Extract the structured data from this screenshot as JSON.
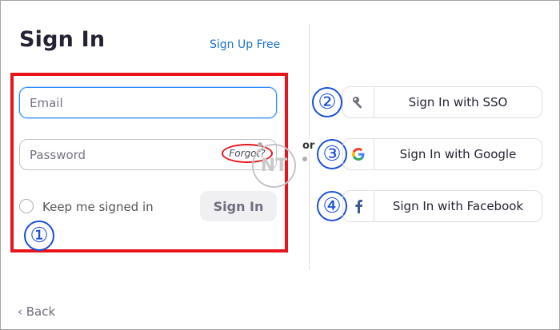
{
  "signin": {
    "title": "Sign In",
    "signup_link": "Sign Up Free",
    "email_placeholder": "Email",
    "password_placeholder": "Password",
    "forgot": "Forgot?",
    "keep_signed_in": "Keep me signed in",
    "button": "Sign In"
  },
  "separator": {
    "or": "or"
  },
  "watermark": {
    "text": "NT"
  },
  "sso": {
    "sso_label": "Sign In with SSO",
    "google_label": "Sign In with Google",
    "facebook_label": "Sign In with Facebook"
  },
  "annotations": [
    "①",
    "②",
    "③",
    "④"
  ],
  "footer": {
    "back": "‹ Back"
  },
  "colors": {
    "accent": "#2d8cff",
    "link": "#1a73c8",
    "annotation_red": "#e8141b",
    "annotation_blue": "#1a4fd6",
    "facebook": "#3b5998"
  }
}
